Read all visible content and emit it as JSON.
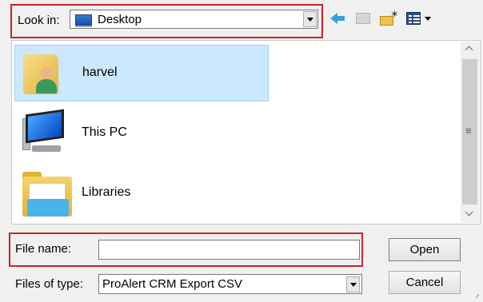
{
  "look_in": {
    "label": "Look in:",
    "value": "Desktop",
    "icon": "desktop-icon"
  },
  "toolbar": {
    "icons": [
      "back-arrow-icon",
      "up-folder-icon",
      "new-folder-icon",
      "view-menu-icon"
    ]
  },
  "files": [
    {
      "name": "harvel",
      "icon": "user-folder-icon",
      "selected": true
    },
    {
      "name": "This PC",
      "icon": "computer-icon",
      "selected": false
    },
    {
      "name": "Libraries",
      "icon": "libraries-icon",
      "selected": false
    }
  ],
  "file_name": {
    "label": "File name:",
    "value": ""
  },
  "file_type": {
    "label": "Files of type:",
    "value": "ProAlert CRM Export CSV"
  },
  "buttons": {
    "open": "Open",
    "cancel": "Cancel"
  },
  "colors": {
    "highlight_box": "#c4252b",
    "selection": "#cce8ff"
  }
}
